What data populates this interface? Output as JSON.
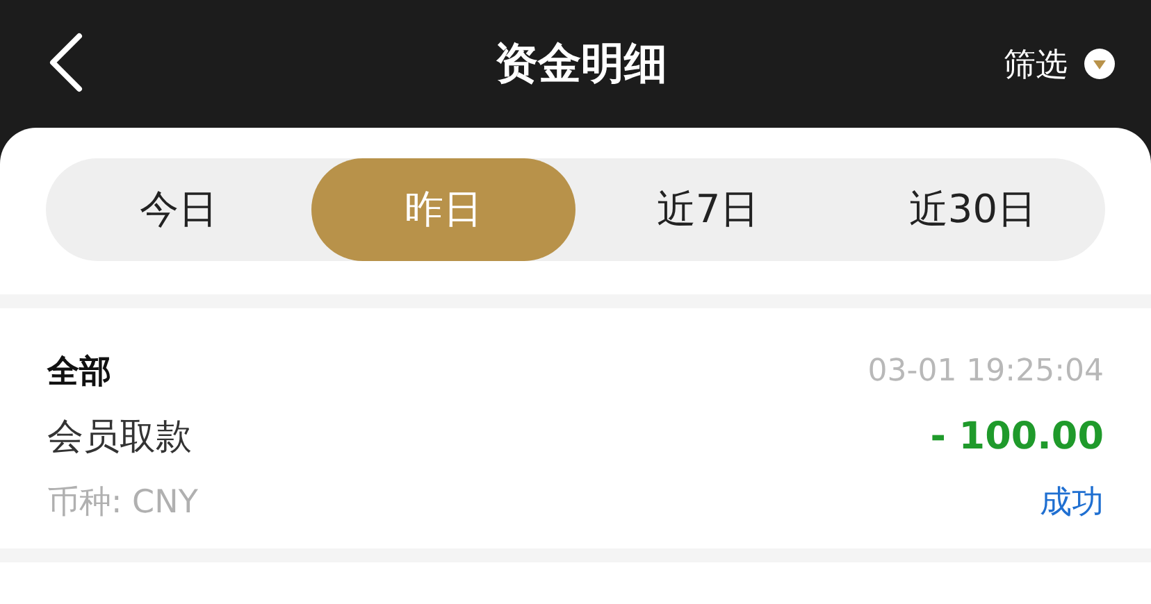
{
  "header": {
    "title": "资金明细",
    "filter_label": "筛选"
  },
  "tabs": [
    {
      "label": "今日",
      "selected": false
    },
    {
      "label": "昨日",
      "selected": true
    },
    {
      "label": "近7日",
      "selected": false
    },
    {
      "label": "近30日",
      "selected": false
    }
  ],
  "records": [
    {
      "category": "全部",
      "time": "03-01 19:25:04",
      "type": "会员取款",
      "amount": "- 100.00",
      "currency": "币种: CNY",
      "status": "成功"
    }
  ]
}
